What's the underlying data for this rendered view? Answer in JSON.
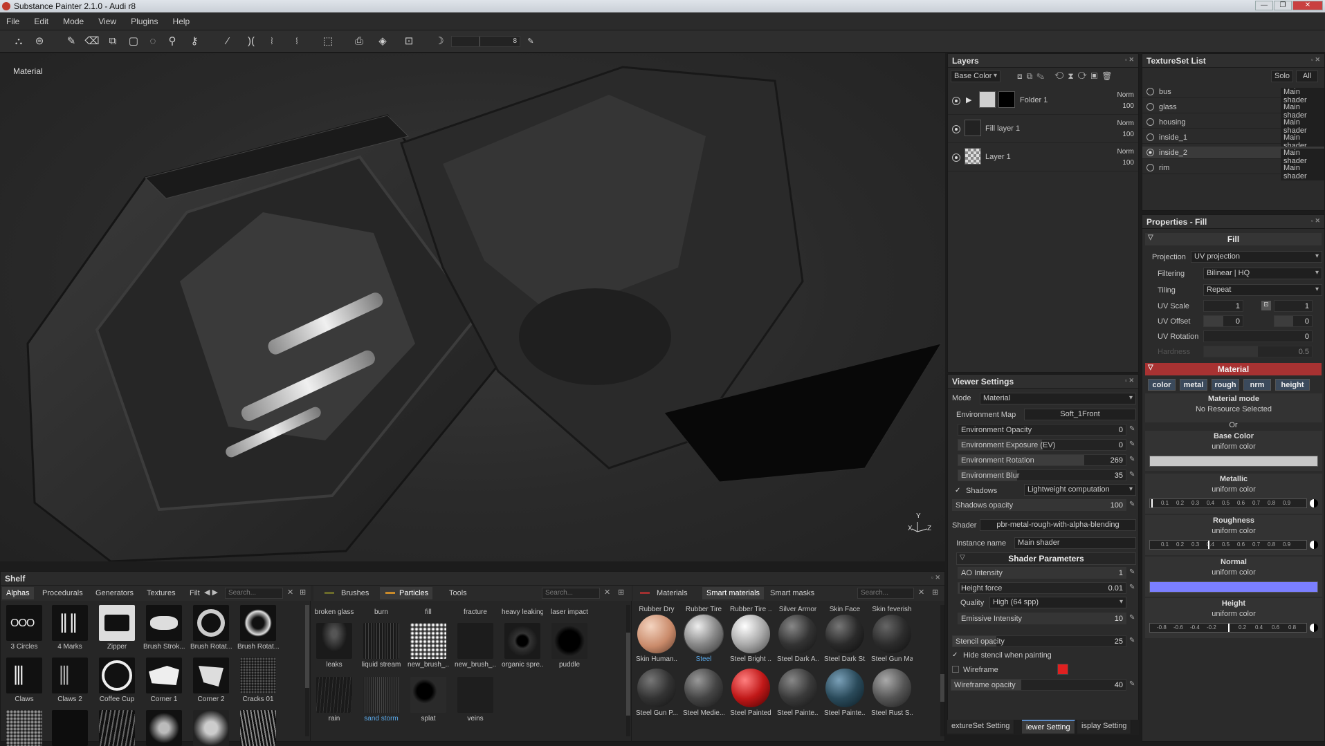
{
  "window": {
    "title": "Substance Painter 2.1.0 - Audi r8",
    "min": "—",
    "max": "❐",
    "close": "✕"
  },
  "menu": [
    "File",
    "Edit",
    "Mode",
    "View",
    "Plugins",
    "Help"
  ],
  "toolbar": {
    "brush_size_value": "8"
  },
  "viewport": {
    "label": "Material",
    "axis_y": "Y",
    "axis_x": "X",
    "axis_z": "Z"
  },
  "layers": {
    "title": "Layers",
    "channel": "Base Color",
    "items": [
      {
        "name": "Folder 1",
        "blend": "Norm",
        "opacity": "100"
      },
      {
        "name": "Fill layer 1",
        "blend": "Norm",
        "opacity": "100"
      },
      {
        "name": "Layer 1",
        "blend": "Norm",
        "opacity": "100"
      }
    ]
  },
  "textureset": {
    "title": "TextureSet List",
    "solo": "Solo",
    "all": "All",
    "items": [
      {
        "name": "bus",
        "shader": "Main shader"
      },
      {
        "name": "glass",
        "shader": "Main shader"
      },
      {
        "name": "housing",
        "shader": "Main shader"
      },
      {
        "name": "inside_1",
        "shader": "Main shader"
      },
      {
        "name": "inside_2",
        "shader": "Main shader"
      },
      {
        "name": "rim",
        "shader": "Main shader"
      }
    ]
  },
  "properties": {
    "title": "Properties - Fill",
    "fill_section": "Fill",
    "projection_label": "Projection",
    "projection": "UV projection",
    "filtering_label": "Filtering",
    "filtering": "Bilinear | HQ",
    "tiling_label": "Tiling",
    "tiling": "Repeat",
    "uvscale_label": "UV Scale",
    "uvscale_a": "1",
    "uvscale_b": "1",
    "uvoffset_label": "UV Offset",
    "uvoffset_a": "0",
    "uvoffset_b": "0",
    "uvrotation_label": "UV Rotation",
    "uvrotation": "0",
    "hardness_label": "Hardness",
    "hardness": "0.5",
    "material_section": "Material",
    "channels": [
      "color",
      "metal",
      "rough",
      "nrm",
      "height"
    ],
    "material_mode": "Material mode",
    "no_resource": "No Resource Selected",
    "or": "Or",
    "base_color": "Base Color",
    "uniform": "uniform color",
    "metallic": "Metallic",
    "roughness": "Roughness",
    "normal": "Normal",
    "height": "Height",
    "ramp_ticks": [
      "0.1",
      "0.2",
      "0.3",
      "0.4",
      "0.5",
      "0.6",
      "0.7",
      "0.8",
      "0.9"
    ],
    "height_ticks": [
      "-0.8",
      "-0.6",
      "-0.4",
      "-0.2",
      "0.2",
      "0.4",
      "0.6",
      "0.8"
    ],
    "base_color_hex": "#c8c8c8",
    "normal_color_hex": "#7b7fff",
    "material_header_color": "#a83232"
  },
  "viewer": {
    "title": "Viewer Settings",
    "mode_label": "Mode",
    "mode": "Material",
    "envmap_label": "Environment Map",
    "envmap": "Soft_1Front",
    "env_opacity_label": "Environment Opacity",
    "env_opacity": "0",
    "env_exposure_label": "Environment Exposure (EV)",
    "env_exposure": "0",
    "env_rotation_label": "Environment Rotation",
    "env_rotation": "269",
    "env_blur_label": "Environment Blur",
    "env_blur": "35",
    "shadows_label": "Shadows",
    "shadows_mode": "Lightweight computation",
    "shadows_opacity_label": "Shadows opacity",
    "shadows_opacity": "100",
    "shader_label": "Shader",
    "shader": "pbr-metal-rough-with-alpha-blending",
    "instance_label": "Instance name",
    "instance": "Main shader",
    "shader_params": "Shader Parameters",
    "ao_label": "AO Intensity",
    "ao": "1",
    "height_force_label": "Height force",
    "height_force": "0.01",
    "quality_label": "Quality",
    "quality": "High (64 spp)",
    "emissive_label": "Emissive Intensity",
    "emissive": "10",
    "stencil_label": "Stencil opacity",
    "stencil": "25",
    "hide_stencil_label": "Hide stencil when painting",
    "wireframe_label": "Wireframe",
    "wireframe_opacity_label": "Wireframe opacity",
    "wireframe_opacity": "40",
    "wireframe_color": "#e02020"
  },
  "bottom_tabs": [
    "extureSet Setting",
    "iewer Setting",
    "isplay Setting"
  ],
  "shelf": {
    "title": "Shelf",
    "tabs": [
      "Alphas",
      "Procedurals",
      "Generators",
      "Textures",
      "Filt"
    ],
    "search": "Search...",
    "alphas": [
      "3 Circles",
      "4 Marks",
      "Zipper",
      "Brush Strok...",
      "Brush Rotat...",
      "Brush Rotat...",
      "Claws",
      "Claws 2",
      "Coffee Cup",
      "Corner 1",
      "Corner 2",
      "Cracks 01",
      "",
      "",
      "",
      "",
      "",
      ""
    ],
    "brushes_tabs": [
      "Brushes",
      "Particles",
      "Tools"
    ],
    "particles": [
      "broken glass",
      "burn",
      "fill",
      "fracture",
      "heavy leaking",
      "laser impact",
      "leaks",
      "liquid stream",
      "new_brush_...",
      "new_brush_...",
      "organic spre...",
      "puddle",
      "rain",
      "sand storm",
      "splat",
      "veins"
    ],
    "materials_tabs": [
      "Materials",
      "Smart materials",
      "Smart masks"
    ],
    "mat_top": [
      "Rubber Dry",
      "Rubber Tire",
      "Rubber Tire ...",
      "Silver Armor",
      "Skin Face",
      "Skin feverish"
    ],
    "materials": [
      "Skin Human...",
      "Steel",
      "Steel Bright ...",
      "Steel Dark A...",
      "Steel Dark St...",
      "Steel Gun Mat",
      "Steel Gun P...",
      "Steel Medie...",
      "Steel Painted",
      "Steel Painte...",
      "Steel Painte...",
      "Steel Rust S..."
    ]
  }
}
